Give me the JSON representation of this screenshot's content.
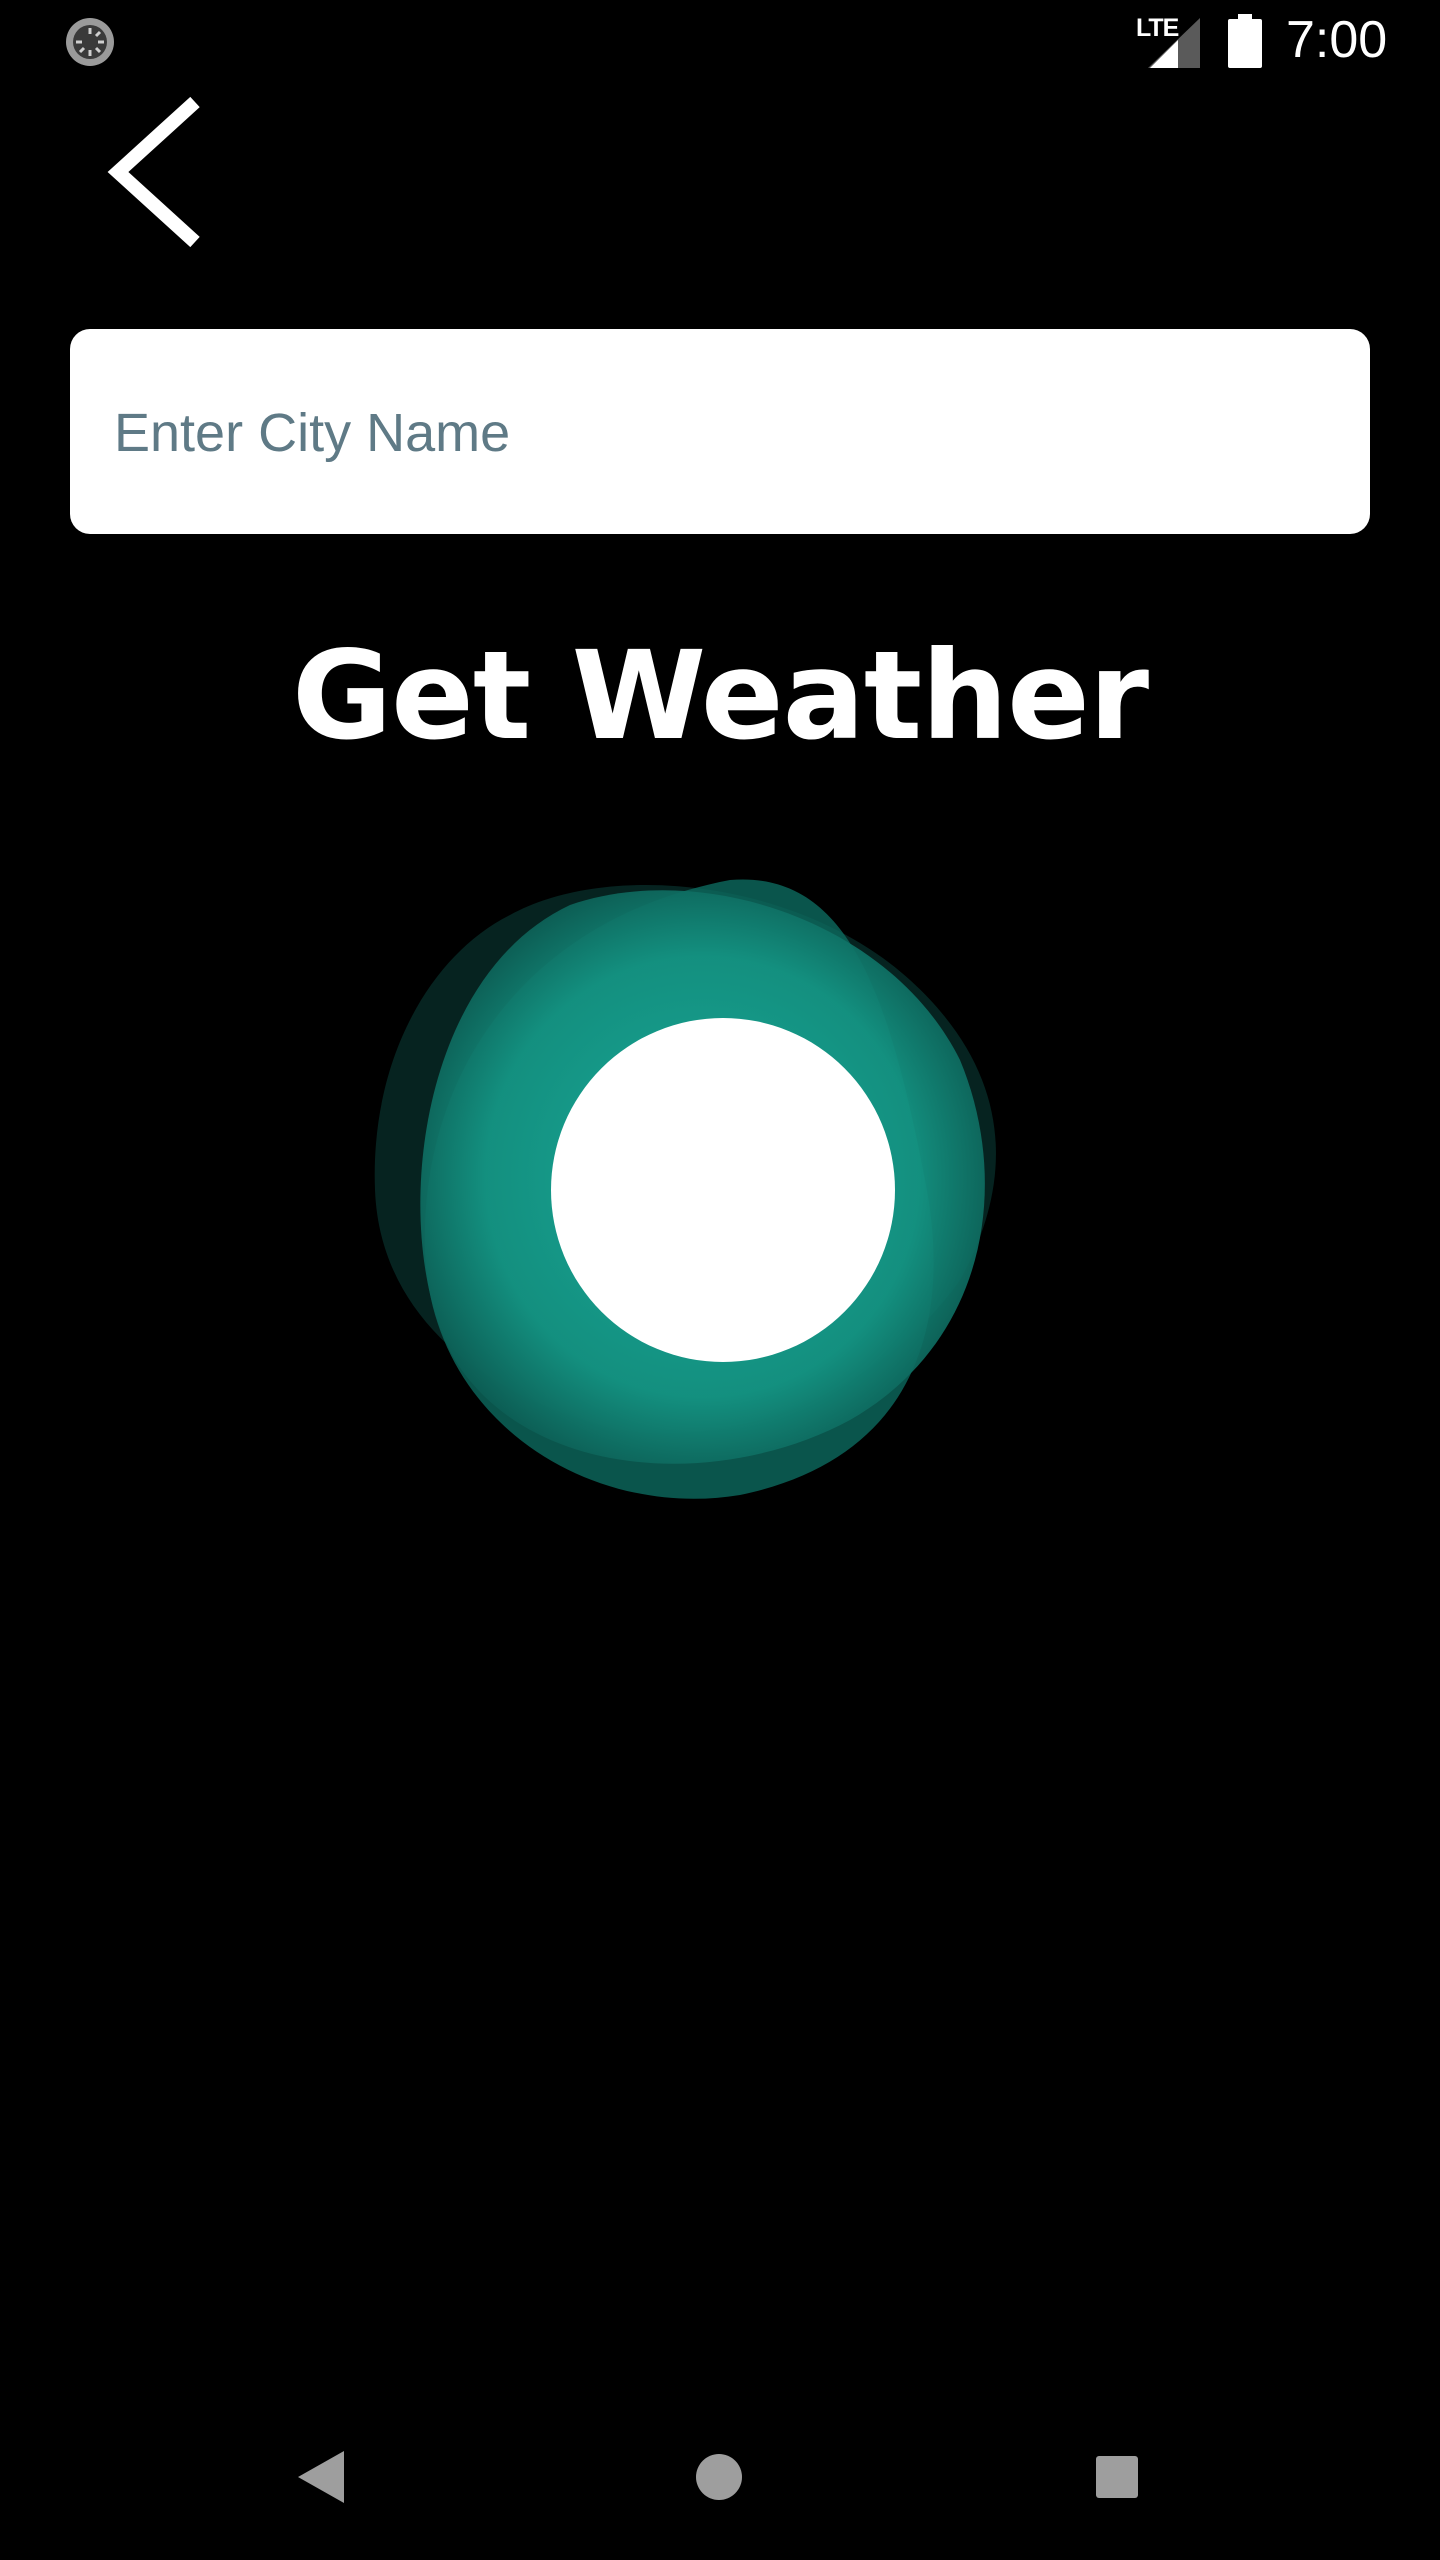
{
  "status_bar": {
    "time": "7:00",
    "network_label": "LTE",
    "icons": [
      "sync-icon",
      "signal-icon",
      "battery-icon"
    ]
  },
  "toolbar": {
    "back_icon": "chevron-left-icon"
  },
  "search": {
    "value": "",
    "placeholder": "Enter City Name"
  },
  "action": {
    "label": "Get Weather"
  },
  "loader": {
    "icon": "loading-blob-icon",
    "accent_color": "#1aa898"
  },
  "nav_bar": {
    "icons": [
      "nav-back-icon",
      "nav-home-icon",
      "nav-recents-icon"
    ]
  },
  "colors": {
    "background": "#000000",
    "input_background": "#ffffff",
    "placeholder": "#5f7a86",
    "accent": "#1aa898"
  }
}
